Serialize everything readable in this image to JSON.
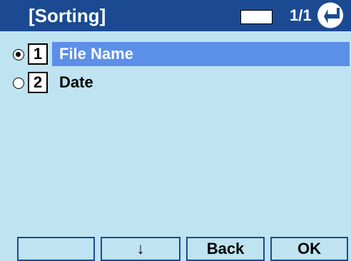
{
  "header": {
    "title": "[Sorting]",
    "page": "1/1"
  },
  "menu": {
    "items": [
      {
        "number": "1",
        "label": "File Name",
        "selected": true
      },
      {
        "number": "2",
        "label": "Date",
        "selected": false
      }
    ]
  },
  "softkeys": [
    "",
    "↓",
    "Back",
    "OK"
  ],
  "colors": {
    "header_bg": "#1b4a92",
    "screen_bg": "#bfe3f0",
    "highlight": "#5b8fe8"
  }
}
